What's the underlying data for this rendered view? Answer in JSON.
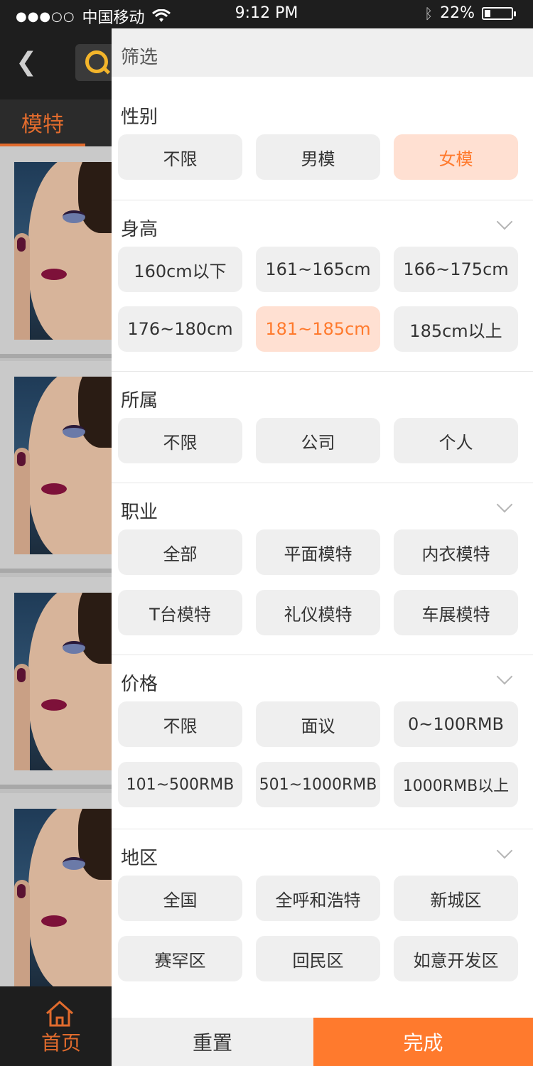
{
  "status_bar": {
    "carrier": "中国移动",
    "signal": "●●●○○",
    "time": "9:12 PM",
    "battery_text": "22%",
    "battery_level": 0.22
  },
  "background": {
    "tab_label": "模特",
    "home_label": "首页"
  },
  "filter": {
    "title": "筛选",
    "gender": {
      "title": "性别",
      "options": [
        "不限",
        "男模",
        "女模"
      ],
      "selected": "女模"
    },
    "height": {
      "title": "身高",
      "options": [
        "160cm以下",
        "161~165cm",
        "166~175cm",
        "176~180cm",
        "181~185cm",
        "185cm以上"
      ],
      "selected": "181~185cm"
    },
    "affiliation": {
      "title": "所属",
      "options": [
        "不限",
        "公司",
        "个人"
      ]
    },
    "profession": {
      "title": "职业",
      "options": [
        "全部",
        "平面模特",
        "内衣模特",
        "T台模特",
        "礼仪模特",
        "车展模特"
      ]
    },
    "price": {
      "title": "价格",
      "options": [
        "不限",
        "面议",
        "0~100RMB",
        "101~500RMB",
        "501~1000RMB",
        "1000RMB以上"
      ]
    },
    "region": {
      "title": "地区",
      "options": [
        "全国",
        "全呼和浩特",
        "新城区",
        "赛罕区",
        "回民区",
        "如意开发区"
      ]
    },
    "reset_label": "重置",
    "done_label": "完成"
  },
  "colors": {
    "accent": "#ff7a2d",
    "chip_bg": "#efefef",
    "chip_active_bg": "#ffe0d2"
  }
}
